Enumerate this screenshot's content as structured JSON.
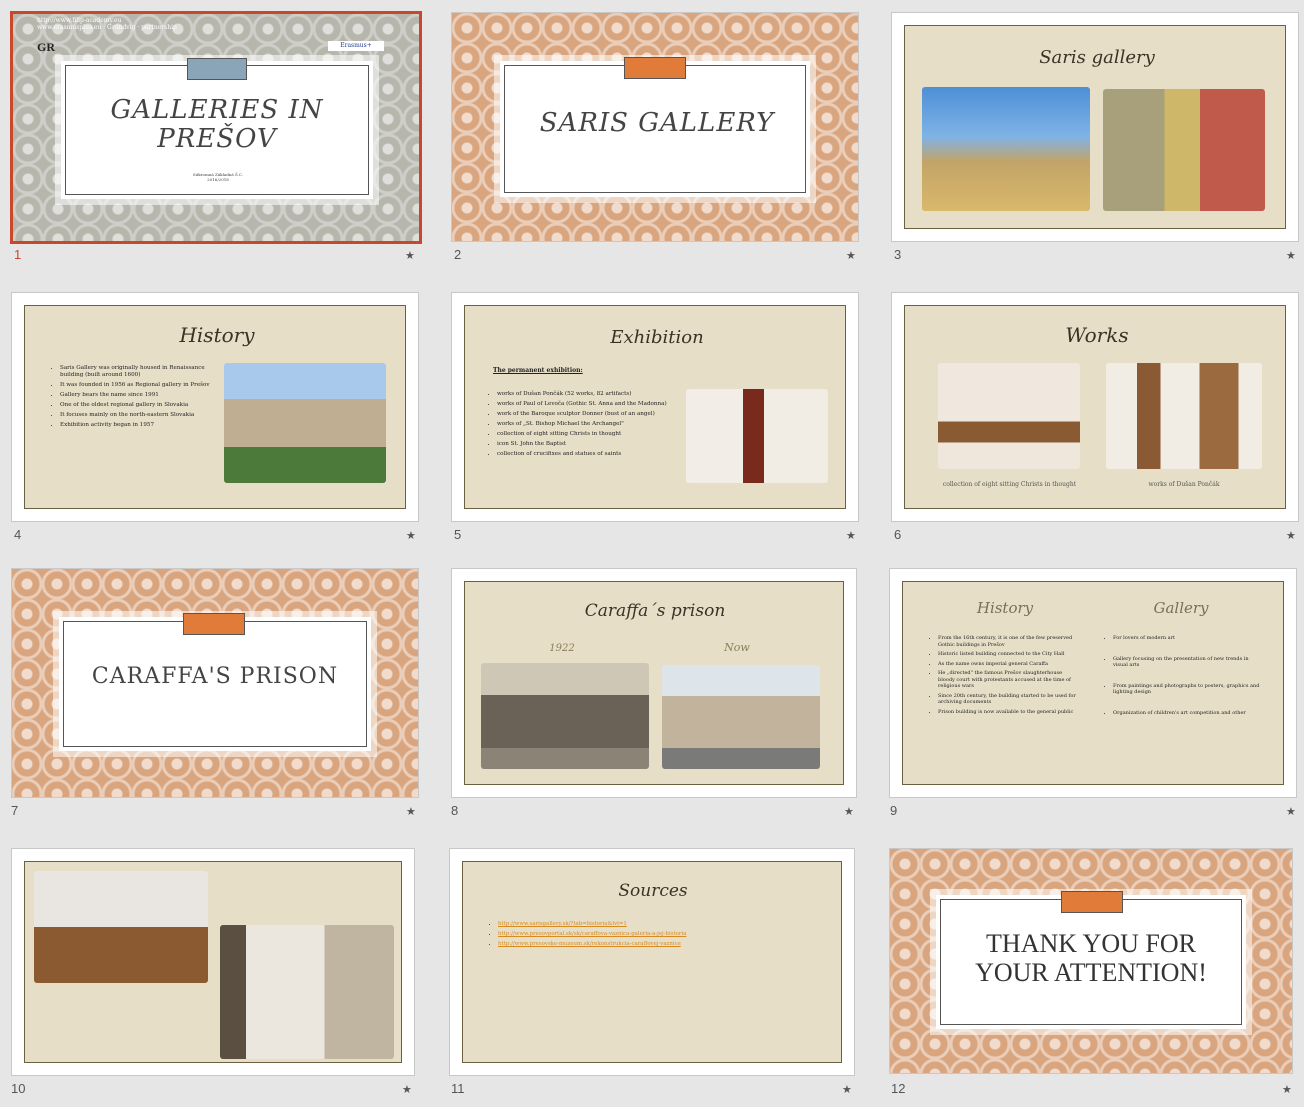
{
  "slides": [
    {
      "num": "1",
      "top_text_1": "http://www.filip-academy.eu",
      "top_text_2": "www.erasmusplus.eu · Grundvig · partnership",
      "title": "GALLERIES IN PREŠOV",
      "subtitle_1": "Súkromná Základná Š.C.",
      "subtitle_2": "2016/2018",
      "logo": "GR",
      "badge": "Erasmus+"
    },
    {
      "num": "2",
      "title": "SARIS GALLERY"
    },
    {
      "num": "3",
      "title": "Saris gallery"
    },
    {
      "num": "4",
      "title": "History",
      "bullets": [
        "Saris Gallery was originally housed in Renaissance building (built around 1600)",
        "It was founded in 1956 as Regional gallery in Prešov",
        "Gallery bears the name since 1991",
        "One of the oldest regional gallery in Slovakia",
        "It focuses mainly on the north-eastern Slovakia",
        "Exhibition activity began in 1957"
      ]
    },
    {
      "num": "5",
      "title": "Exhibition",
      "subhead": "The permanent exhibition:",
      "bullets": [
        "works of Dušan Pončák (52 works, 82 artifacts)",
        "works of Paul of Levoča (Gothic St. Anna and the Madonna)",
        "work of the Baroque sculptor Donner (bust of an angel)",
        "works of „St. Bishop Michael the Archangel\"",
        "collection of eight sitting Christs in thought",
        "icon St. John the Baptist",
        "collection of crucifixes and statues of saints"
      ]
    },
    {
      "num": "6",
      "title": "Works",
      "caption_left": "collection of eight sitting Christs in thought",
      "caption_right": "works of Dušan Pončák"
    },
    {
      "num": "7",
      "title": "CARAFFA'S PRISON"
    },
    {
      "num": "8",
      "title": "Caraffa´s prison",
      "label_left": "1922",
      "label_right": "Now"
    },
    {
      "num": "9",
      "heading_left": "History",
      "heading_right": "Gallery",
      "bullets_left": [
        "From the 16th century, it is one of the few preserved Gothic buildings in Prešov",
        "Historic listed building connected to the City Hall",
        "As the name owns imperial general Caraffa",
        "He „directed\" the famous Prešov slaughterhouse bloody court with protestants accused at the time of religious wars",
        "Since 20th century, the building started to be used for archiving documents",
        "Prison building is now available to the general public"
      ],
      "bullets_right": [
        "For lovers of modern art",
        "Gallery focusing on the presentation of new trends in visual arts",
        "From paintings and photographs to posters, graphics and lighting design",
        "Organization of children's art competition and other"
      ]
    },
    {
      "num": "10"
    },
    {
      "num": "11",
      "title": "Sources",
      "links": [
        "http://www.sarisgallery.sk/?tab=historia&lvl=1",
        "http://www.presovportal.sk/sk/caraffova-vaznica-galeria-a-jej-historia",
        "http://www.presovske-muzeum.sk/rekonstrukcia-caraffovej-vaznice"
      ]
    },
    {
      "num": "12",
      "title": "THANK YOU FOR YOUR ATTENTION!"
    }
  ],
  "icons": {
    "star": "★"
  },
  "colors": {
    "selected": "#c9472a",
    "accent_orange": "#e07b39",
    "accent_blue": "#8aa4b8",
    "beige": "#e6dec6"
  }
}
